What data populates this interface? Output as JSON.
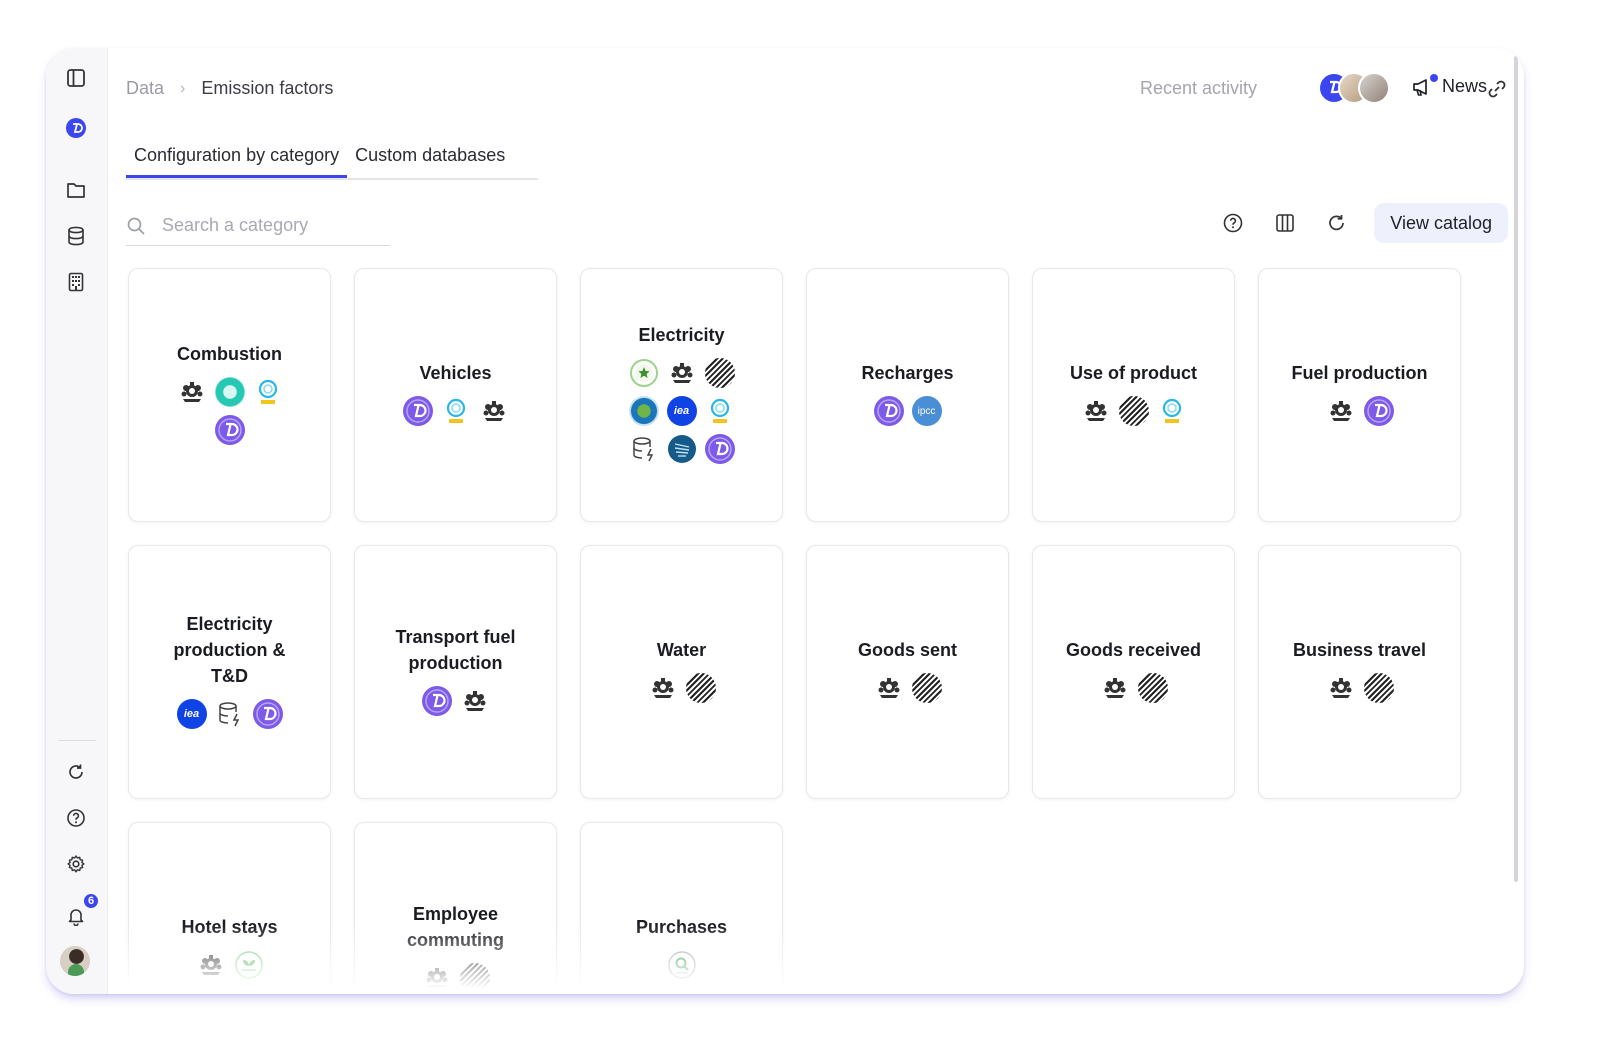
{
  "breadcrumb": {
    "root": "Data",
    "separator": "›",
    "current": "Emission factors"
  },
  "header": {
    "recent_activity": "Recent activity",
    "news": "News"
  },
  "tabs": [
    {
      "label": "Configuration by category",
      "active": true
    },
    {
      "label": "Custom databases",
      "active": false
    }
  ],
  "search": {
    "placeholder": "Search a category"
  },
  "toolbar": {
    "view_catalog": "View catalog"
  },
  "sidebar": {
    "notifications_count": "6"
  },
  "logo_text": {
    "iea": "iea",
    "ipcc": "ipcc"
  },
  "categories": [
    {
      "title": "Combustion",
      "logos": [
        "uk-gov-crest",
        "teal-ring",
        "c-logo",
        "d-logo"
      ]
    },
    {
      "title": "Vehicles",
      "logos": [
        "d-logo",
        "c-logo",
        "uk-gov-crest"
      ]
    },
    {
      "title": "Electricity",
      "logos": [
        "star-logo",
        "uk-gov-crest",
        "stripe-globe",
        "epa-logo",
        "iea-logo",
        "c-logo",
        "database-icon",
        "blue-feather",
        "d-logo"
      ]
    },
    {
      "title": "Recharges",
      "logos": [
        "d-logo",
        "ipcc-logo"
      ]
    },
    {
      "title": "Use of product",
      "logos": [
        "uk-gov-crest",
        "stripe-globe",
        "c-logo"
      ]
    },
    {
      "title": "Fuel production",
      "logos": [
        "uk-gov-crest",
        "d-logo"
      ]
    },
    {
      "title": "Electricity production & T&D",
      "logos": [
        "iea-logo",
        "database-icon",
        "d-logo"
      ]
    },
    {
      "title": "Transport fuel production",
      "logos": [
        "d-logo",
        "uk-gov-crest"
      ]
    },
    {
      "title": "Water",
      "logos": [
        "uk-gov-crest",
        "stripe-globe"
      ]
    },
    {
      "title": "Goods sent",
      "logos": [
        "uk-gov-crest",
        "stripe-globe"
      ]
    },
    {
      "title": "Goods received",
      "logos": [
        "uk-gov-crest",
        "stripe-globe"
      ]
    },
    {
      "title": "Business travel",
      "logos": [
        "uk-gov-crest",
        "stripe-globe"
      ]
    },
    {
      "title": "Hotel stays",
      "logos": [
        "uk-gov-crest",
        "greenview-logo"
      ]
    },
    {
      "title": "Employee commuting",
      "logos": [
        "uk-gov-crest",
        "stripe-globe"
      ]
    },
    {
      "title": "Purchases",
      "logos": [
        "magnifier-logo"
      ]
    }
  ],
  "colors": {
    "accent": "#3b46f1",
    "brand_purple": "#7d5ae8"
  }
}
